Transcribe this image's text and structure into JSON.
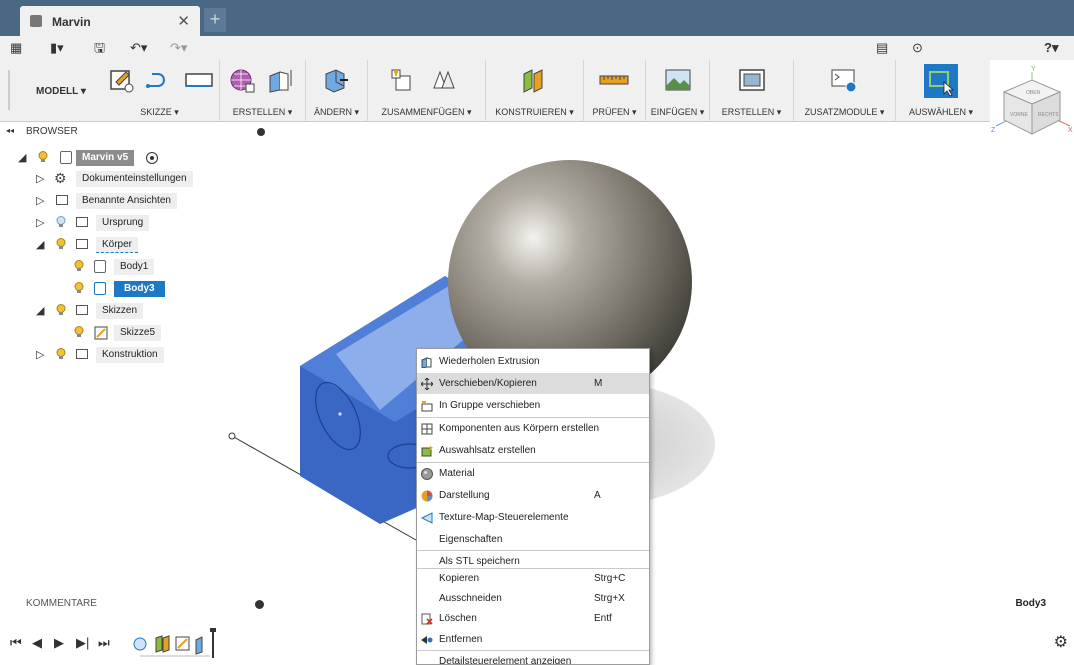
{
  "tab": {
    "title": "Marvin",
    "close": "✕",
    "new": "+"
  },
  "qat": {
    "grid": "▦",
    "file": "▮▾",
    "save": "🖫",
    "undo": "↶▾",
    "redo": "↷▾",
    "comment": "▤",
    "clock": "⊙",
    "help": "?▾"
  },
  "ribbon": {
    "workspace": "MODELL ▾",
    "groups": [
      {
        "label": "SKIZZE ▾"
      },
      {
        "label": "ERSTELLEN ▾"
      },
      {
        "label": "ÄNDERN ▾"
      },
      {
        "label": "ZUSAMMENFÜGEN ▾"
      },
      {
        "label": "KONSTRUIEREN ▾"
      },
      {
        "label": "PRÜFEN ▾"
      },
      {
        "label": "EINFÜGEN ▾"
      },
      {
        "label": "ERSTELLEN ▾"
      },
      {
        "label": "ZUSATZMODULE ▾"
      },
      {
        "label": "AUSWÄHLEN ▾"
      }
    ]
  },
  "browser": {
    "title": "BROWSER",
    "collapse": "◂◂",
    "nodes": {
      "root": "Marvin v5",
      "doc_settings": "Dokumenteinstellungen",
      "named_views": "Benannte Ansichten",
      "origin": "Ursprung",
      "bodies": "Körper",
      "body1": "Body1",
      "body3": "Body3",
      "sketches": "Skizzen",
      "sketch5": "Skizze5",
      "construction": "Konstruktion"
    }
  },
  "comments": {
    "label": "KOMMENTARE"
  },
  "status": {
    "selection": "Body3"
  },
  "viewcube": {
    "front": "VORNE",
    "right": "RECHTS",
    "top": "OBEN",
    "axis_x": "X",
    "axis_y": "Y",
    "axis_z": "Z"
  },
  "timeline": {
    "first": "⏮",
    "prev": "◀",
    "play": "▶",
    "next": "▶|",
    "last": "⏭"
  },
  "menu": {
    "items": [
      {
        "label": "Wiederholen Extrusion",
        "key": ""
      },
      {
        "label": "Verschieben/Kopieren",
        "key": "M"
      },
      {
        "label": "In Gruppe verschieben",
        "key": ""
      },
      {
        "label": "Komponenten aus Körpern erstellen",
        "key": ""
      },
      {
        "label": "Auswahlsatz erstellen",
        "key": ""
      },
      {
        "label": "Material",
        "key": ""
      },
      {
        "label": "Darstellung",
        "key": "A"
      },
      {
        "label": "Texture-Map-Steuerelemente",
        "key": ""
      },
      {
        "label": "Eigenschaften",
        "key": ""
      },
      {
        "label": "Als STL speichern",
        "key": ""
      },
      {
        "label": "Kopieren",
        "key": "Strg+C"
      },
      {
        "label": "Ausschneiden",
        "key": "Strg+X"
      },
      {
        "label": "Löschen",
        "key": "Entf"
      },
      {
        "label": "Entfernen",
        "key": ""
      },
      {
        "label": "Detailsteuerelement anzeigen",
        "key": ""
      }
    ]
  },
  "colors": {
    "accent": "#1f78c6",
    "tabbar": "#4a6784",
    "body_blue": "#3a66c4"
  }
}
